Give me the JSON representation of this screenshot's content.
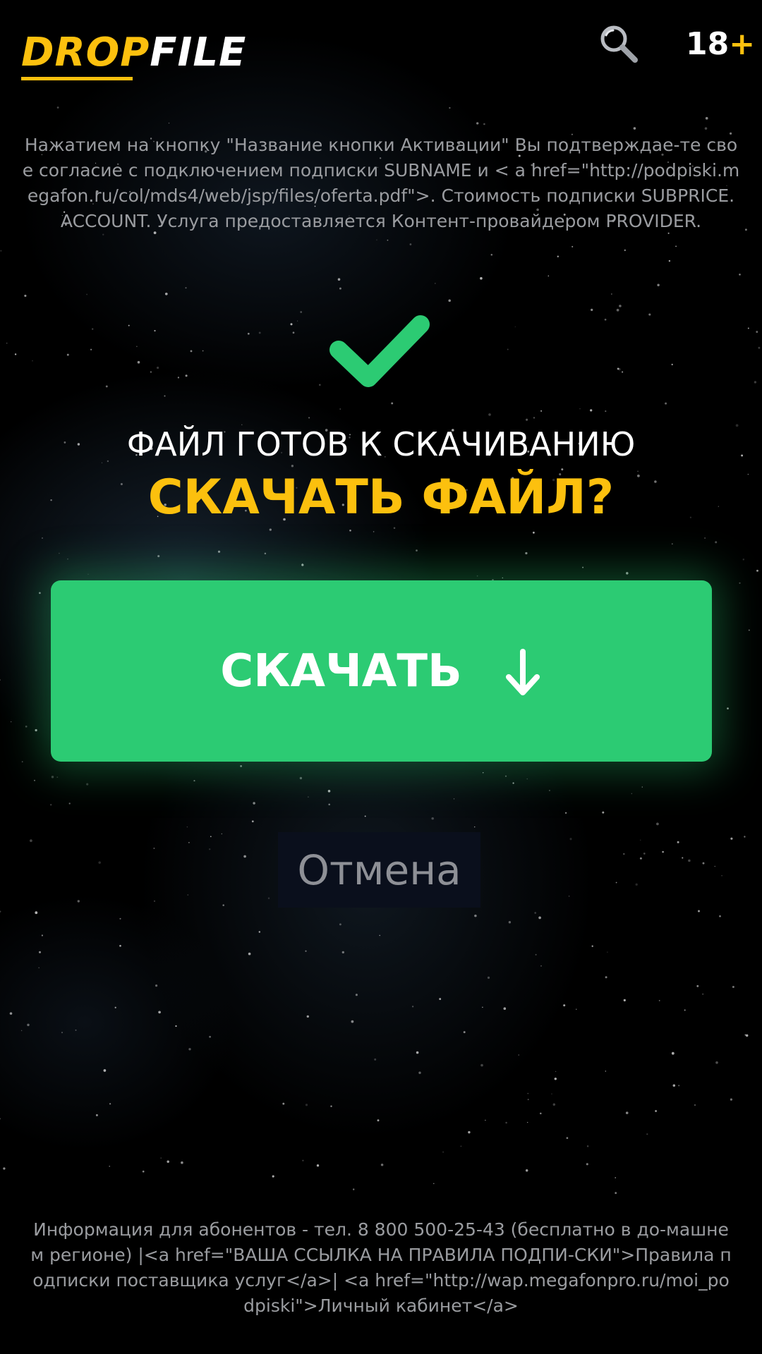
{
  "header": {
    "logo_part1": "DROP",
    "logo_part2": "FILE",
    "search_icon": "search-icon",
    "age_number": "18",
    "age_plus": "+"
  },
  "disclaimer": {
    "text": "Нажатием на кнопку \"Название кнопки Активации\" Вы подтверждае-те свое согласие с подключением подписки SUBNAME и < a href=\"http://podpiski.megafon.ru/col/mds4/web/jsp/files/oferta.pdf\">. Стоимость подписки SUBPRICE. ACCOUNT. Услуга предоставляется Контент-провайдером PROVIDER."
  },
  "main": {
    "check_icon": "checkmark-icon",
    "ready_text": "ФАЙЛ ГОТОВ К СКАЧИВАНИЮ",
    "question": "СКАЧАТЬ ФАЙЛ?",
    "download_label": "СКАЧАТЬ",
    "download_icon": "arrow-down-icon",
    "cancel_label": "Отмена"
  },
  "footer": {
    "text": "Информация для абонентов - тел. 8 800 500-25-43 (бесплатно в до-машнем регионе) |<a href=\"ВАША ССЫЛКА НА ПРАВИЛА ПОДПИ-СКИ\">Правила подписки поставщика услуг</a>| <a href=\"http://wap.megafonpro.ru/moi_podpiski\">Личный кабинет</a>"
  },
  "colors": {
    "accent_yellow": "#fcc00e",
    "button_green": "#2ccb73",
    "background": "#000000",
    "muted_text": "#9a9ca0"
  }
}
